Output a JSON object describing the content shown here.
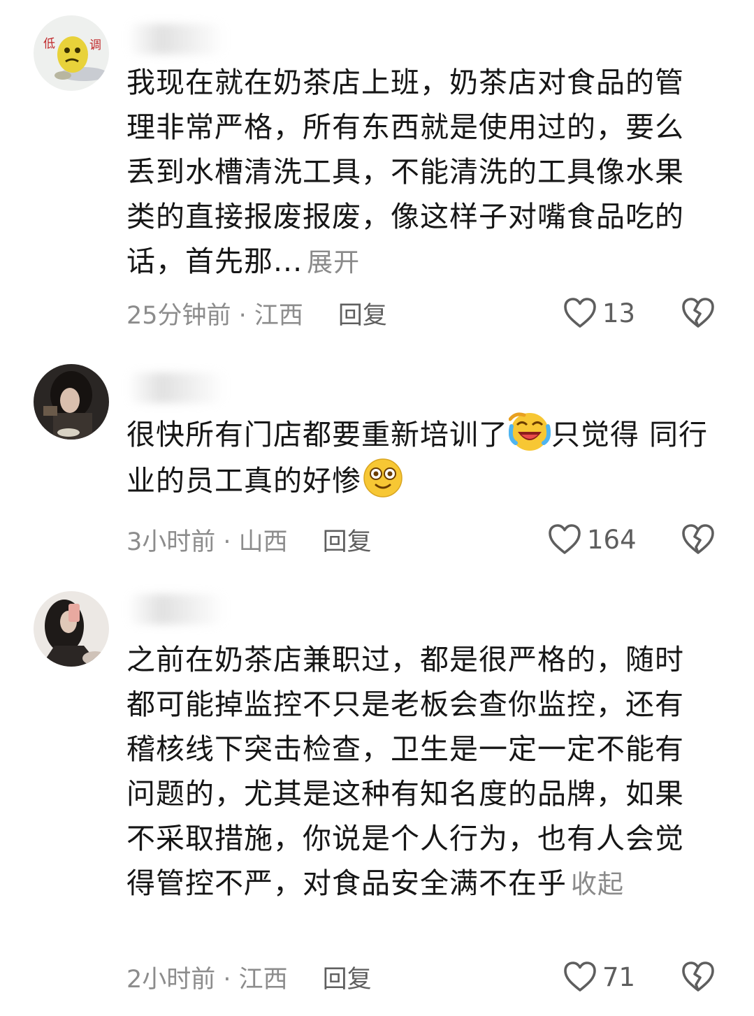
{
  "comments": [
    {
      "content": "我现在就在奶茶店上班，奶茶店对食品的管理非常严格，所有东西就是使用过的，要么丢到水槽清洗工具，不能清洗的工具像水果类的直接报废报废，像这样子对嘴食品吃的话，首先那...",
      "toggle": "展开",
      "time_location": "25分钟前 · 江西",
      "reply": "回复",
      "likes": "13",
      "avatar_text": [
        "低",
        "调"
      ]
    },
    {
      "content_part1": "很快所有门店都要重新培训了",
      "content_part2": "只觉得 同行业的员工真的好惨",
      "time_location": "3小时前 · 山西",
      "reply": "回复",
      "likes": "164",
      "emojis": [
        "laughing-crying-emoji",
        "dizzy-smile-emoji"
      ]
    },
    {
      "content": "之前在奶茶店兼职过，都是很严格的，随时都可能掉监控不只是老板会查你监控，还有稽核线下突击检查，卫生是一定一定不能有问题的，尤其是这种有知名度的品牌，如果不采取措施，你说是个人行为，也有人会觉得管控不严，对食品安全满不在乎",
      "toggle": "收起",
      "time_location": "2小时前 · 江西",
      "reply": "回复",
      "likes": "71"
    }
  ],
  "colors": {
    "text": "#161616",
    "meta": "#8c8c8c",
    "reply": "#5f5f5f",
    "icon": "#5e5e5e",
    "emoji_yellow": "#f7c734"
  },
  "icons": [
    "heart-outline-icon",
    "broken-heart-icon"
  ]
}
